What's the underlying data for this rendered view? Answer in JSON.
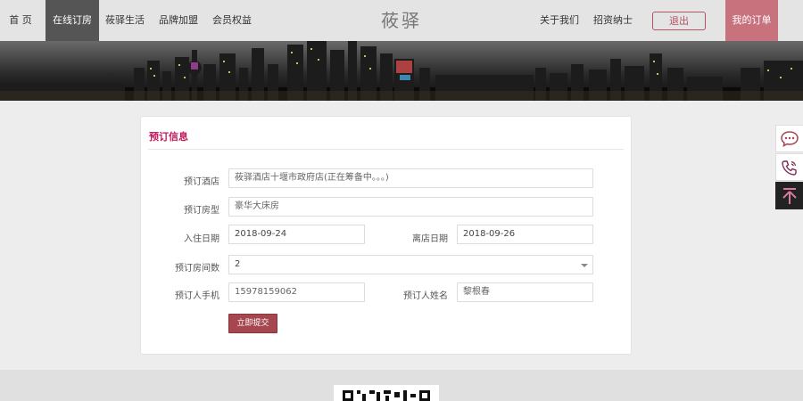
{
  "nav": {
    "home": "首 页",
    "online_booking": "在线订房",
    "lifestyle": "莜驿生活",
    "brand": "品牌加盟",
    "member": "会员权益",
    "logo": "莜驿",
    "about": "关于我们",
    "invest": "招资纳士",
    "logout": "退出",
    "my_orders": "我的订单"
  },
  "form": {
    "title": "预订信息",
    "hotel_label": "预订酒店",
    "hotel_value": "莜驿酒店十堰市政府店(正在筹备中。。。)",
    "room_type_label": "预订房型",
    "room_type_value": "豪华大床房",
    "checkin_label": "入住日期",
    "checkin_value": "2018-09-24",
    "checkout_label": "离店日期",
    "checkout_value": "2018-09-26",
    "rooms_label": "预订房间数",
    "rooms_value": "2",
    "phone_label": "预订人手机",
    "phone_value": "15978159062",
    "name_label": "预订人姓名",
    "name_value": "黎根春",
    "submit_label": "立即提交"
  },
  "side_tools": [
    "chat-icon",
    "phone-icon",
    "back-to-top-icon"
  ],
  "colors": {
    "accent": "#c2185b",
    "button": "#a6474f",
    "my_orders_bg": "#c7727d",
    "active_nav_bg": "#555555"
  }
}
